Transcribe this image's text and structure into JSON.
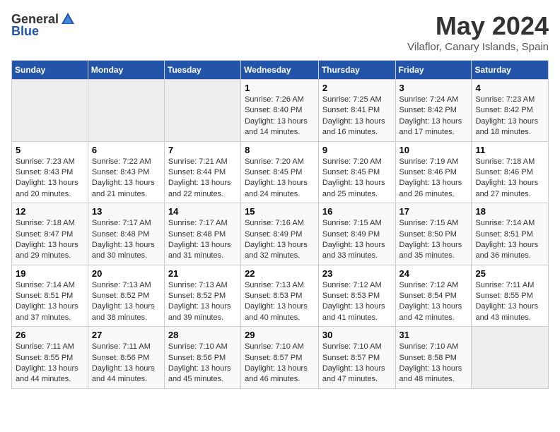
{
  "header": {
    "logo_general": "General",
    "logo_blue": "Blue",
    "title": "May 2024",
    "subtitle": "Vilaflor, Canary Islands, Spain"
  },
  "days_of_week": [
    "Sunday",
    "Monday",
    "Tuesday",
    "Wednesday",
    "Thursday",
    "Friday",
    "Saturday"
  ],
  "weeks": [
    [
      {
        "day": "",
        "empty": true
      },
      {
        "day": "",
        "empty": true
      },
      {
        "day": "",
        "empty": true
      },
      {
        "day": "1",
        "sunrise": "7:26 AM",
        "sunset": "8:40 PM",
        "daylight": "13 hours and 14 minutes."
      },
      {
        "day": "2",
        "sunrise": "7:25 AM",
        "sunset": "8:41 PM",
        "daylight": "13 hours and 16 minutes."
      },
      {
        "day": "3",
        "sunrise": "7:24 AM",
        "sunset": "8:42 PM",
        "daylight": "13 hours and 17 minutes."
      },
      {
        "day": "4",
        "sunrise": "7:23 AM",
        "sunset": "8:42 PM",
        "daylight": "13 hours and 18 minutes."
      }
    ],
    [
      {
        "day": "5",
        "sunrise": "7:23 AM",
        "sunset": "8:43 PM",
        "daylight": "13 hours and 20 minutes."
      },
      {
        "day": "6",
        "sunrise": "7:22 AM",
        "sunset": "8:43 PM",
        "daylight": "13 hours and 21 minutes."
      },
      {
        "day": "7",
        "sunrise": "7:21 AM",
        "sunset": "8:44 PM",
        "daylight": "13 hours and 22 minutes."
      },
      {
        "day": "8",
        "sunrise": "7:20 AM",
        "sunset": "8:45 PM",
        "daylight": "13 hours and 24 minutes."
      },
      {
        "day": "9",
        "sunrise": "7:20 AM",
        "sunset": "8:45 PM",
        "daylight": "13 hours and 25 minutes."
      },
      {
        "day": "10",
        "sunrise": "7:19 AM",
        "sunset": "8:46 PM",
        "daylight": "13 hours and 26 minutes."
      },
      {
        "day": "11",
        "sunrise": "7:18 AM",
        "sunset": "8:46 PM",
        "daylight": "13 hours and 27 minutes."
      }
    ],
    [
      {
        "day": "12",
        "sunrise": "7:18 AM",
        "sunset": "8:47 PM",
        "daylight": "13 hours and 29 minutes."
      },
      {
        "day": "13",
        "sunrise": "7:17 AM",
        "sunset": "8:48 PM",
        "daylight": "13 hours and 30 minutes."
      },
      {
        "day": "14",
        "sunrise": "7:17 AM",
        "sunset": "8:48 PM",
        "daylight": "13 hours and 31 minutes."
      },
      {
        "day": "15",
        "sunrise": "7:16 AM",
        "sunset": "8:49 PM",
        "daylight": "13 hours and 32 minutes."
      },
      {
        "day": "16",
        "sunrise": "7:15 AM",
        "sunset": "8:49 PM",
        "daylight": "13 hours and 33 minutes."
      },
      {
        "day": "17",
        "sunrise": "7:15 AM",
        "sunset": "8:50 PM",
        "daylight": "13 hours and 35 minutes."
      },
      {
        "day": "18",
        "sunrise": "7:14 AM",
        "sunset": "8:51 PM",
        "daylight": "13 hours and 36 minutes."
      }
    ],
    [
      {
        "day": "19",
        "sunrise": "7:14 AM",
        "sunset": "8:51 PM",
        "daylight": "13 hours and 37 minutes."
      },
      {
        "day": "20",
        "sunrise": "7:13 AM",
        "sunset": "8:52 PM",
        "daylight": "13 hours and 38 minutes."
      },
      {
        "day": "21",
        "sunrise": "7:13 AM",
        "sunset": "8:52 PM",
        "daylight": "13 hours and 39 minutes."
      },
      {
        "day": "22",
        "sunrise": "7:13 AM",
        "sunset": "8:53 PM",
        "daylight": "13 hours and 40 minutes."
      },
      {
        "day": "23",
        "sunrise": "7:12 AM",
        "sunset": "8:53 PM",
        "daylight": "13 hours and 41 minutes."
      },
      {
        "day": "24",
        "sunrise": "7:12 AM",
        "sunset": "8:54 PM",
        "daylight": "13 hours and 42 minutes."
      },
      {
        "day": "25",
        "sunrise": "7:11 AM",
        "sunset": "8:55 PM",
        "daylight": "13 hours and 43 minutes."
      }
    ],
    [
      {
        "day": "26",
        "sunrise": "7:11 AM",
        "sunset": "8:55 PM",
        "daylight": "13 hours and 44 minutes."
      },
      {
        "day": "27",
        "sunrise": "7:11 AM",
        "sunset": "8:56 PM",
        "daylight": "13 hours and 44 minutes."
      },
      {
        "day": "28",
        "sunrise": "7:10 AM",
        "sunset": "8:56 PM",
        "daylight": "13 hours and 45 minutes."
      },
      {
        "day": "29",
        "sunrise": "7:10 AM",
        "sunset": "8:57 PM",
        "daylight": "13 hours and 46 minutes."
      },
      {
        "day": "30",
        "sunrise": "7:10 AM",
        "sunset": "8:57 PM",
        "daylight": "13 hours and 47 minutes."
      },
      {
        "day": "31",
        "sunrise": "7:10 AM",
        "sunset": "8:58 PM",
        "daylight": "13 hours and 48 minutes."
      },
      {
        "day": "",
        "empty": true
      }
    ]
  ]
}
